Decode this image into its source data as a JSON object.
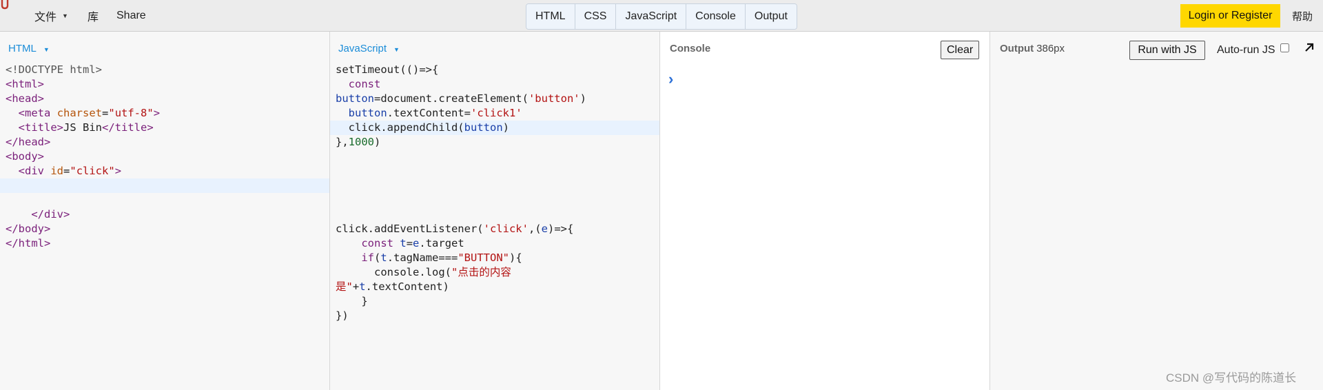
{
  "topbar": {
    "menu": {
      "file": "文件",
      "library": "库",
      "share": "Share"
    },
    "panel_tabs": [
      "HTML",
      "CSS",
      "JavaScript",
      "Console",
      "Output"
    ],
    "login": "Login or Register",
    "help": "帮助"
  },
  "html_pane": {
    "label": "HTML"
  },
  "js_pane": {
    "label": "JavaScript"
  },
  "console": {
    "label": "Console",
    "clear": "Clear",
    "prompt": "›"
  },
  "output": {
    "label": "Output",
    "size": "386px",
    "run": "Run with JS",
    "autorun": "Auto-run JS",
    "autorun_checked": false
  },
  "watermark": "CSDN @写代码的陈道长",
  "colors": {
    "accent": "#1a8cd8",
    "login_bg": "#ffd700",
    "active_line": "#e8f2fe"
  },
  "icons": {
    "logo": "jsbin-logo-icon",
    "popout": "popout-arrow-icon",
    "caret": "caret-down-icon"
  }
}
